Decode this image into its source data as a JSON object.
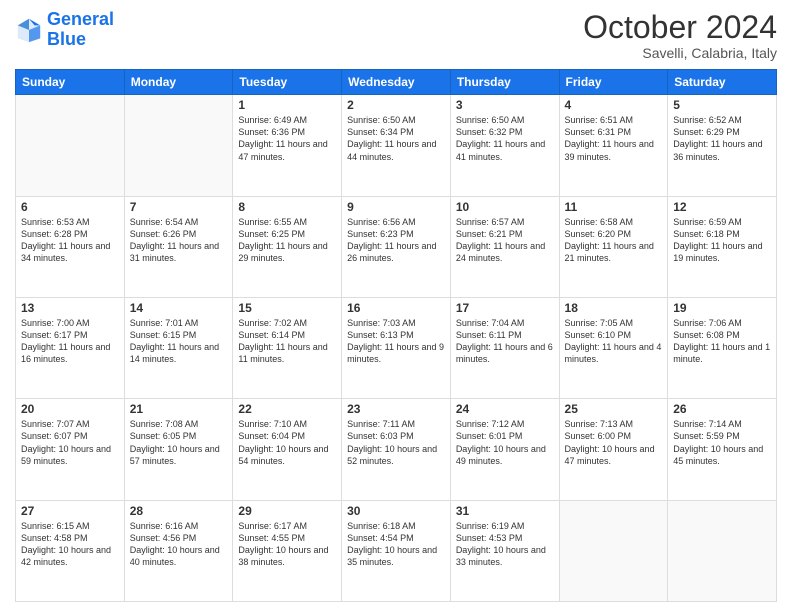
{
  "header": {
    "logo_line1": "General",
    "logo_line2": "Blue",
    "month": "October 2024",
    "location": "Savelli, Calabria, Italy"
  },
  "weekdays": [
    "Sunday",
    "Monday",
    "Tuesday",
    "Wednesday",
    "Thursday",
    "Friday",
    "Saturday"
  ],
  "weeks": [
    [
      null,
      null,
      {
        "day": "1",
        "sunrise": "6:49 AM",
        "sunset": "6:36 PM",
        "daylight": "11 hours and 47 minutes."
      },
      {
        "day": "2",
        "sunrise": "6:50 AM",
        "sunset": "6:34 PM",
        "daylight": "11 hours and 44 minutes."
      },
      {
        "day": "3",
        "sunrise": "6:50 AM",
        "sunset": "6:32 PM",
        "daylight": "11 hours and 41 minutes."
      },
      {
        "day": "4",
        "sunrise": "6:51 AM",
        "sunset": "6:31 PM",
        "daylight": "11 hours and 39 minutes."
      },
      {
        "day": "5",
        "sunrise": "6:52 AM",
        "sunset": "6:29 PM",
        "daylight": "11 hours and 36 minutes."
      }
    ],
    [
      {
        "day": "6",
        "sunrise": "6:53 AM",
        "sunset": "6:28 PM",
        "daylight": "11 hours and 34 minutes."
      },
      {
        "day": "7",
        "sunrise": "6:54 AM",
        "sunset": "6:26 PM",
        "daylight": "11 hours and 31 minutes."
      },
      {
        "day": "8",
        "sunrise": "6:55 AM",
        "sunset": "6:25 PM",
        "daylight": "11 hours and 29 minutes."
      },
      {
        "day": "9",
        "sunrise": "6:56 AM",
        "sunset": "6:23 PM",
        "daylight": "11 hours and 26 minutes."
      },
      {
        "day": "10",
        "sunrise": "6:57 AM",
        "sunset": "6:21 PM",
        "daylight": "11 hours and 24 minutes."
      },
      {
        "day": "11",
        "sunrise": "6:58 AM",
        "sunset": "6:20 PM",
        "daylight": "11 hours and 21 minutes."
      },
      {
        "day": "12",
        "sunrise": "6:59 AM",
        "sunset": "6:18 PM",
        "daylight": "11 hours and 19 minutes."
      }
    ],
    [
      {
        "day": "13",
        "sunrise": "7:00 AM",
        "sunset": "6:17 PM",
        "daylight": "11 hours and 16 minutes."
      },
      {
        "day": "14",
        "sunrise": "7:01 AM",
        "sunset": "6:15 PM",
        "daylight": "11 hours and 14 minutes."
      },
      {
        "day": "15",
        "sunrise": "7:02 AM",
        "sunset": "6:14 PM",
        "daylight": "11 hours and 11 minutes."
      },
      {
        "day": "16",
        "sunrise": "7:03 AM",
        "sunset": "6:13 PM",
        "daylight": "11 hours and 9 minutes."
      },
      {
        "day": "17",
        "sunrise": "7:04 AM",
        "sunset": "6:11 PM",
        "daylight": "11 hours and 6 minutes."
      },
      {
        "day": "18",
        "sunrise": "7:05 AM",
        "sunset": "6:10 PM",
        "daylight": "11 hours and 4 minutes."
      },
      {
        "day": "19",
        "sunrise": "7:06 AM",
        "sunset": "6:08 PM",
        "daylight": "11 hours and 1 minute."
      }
    ],
    [
      {
        "day": "20",
        "sunrise": "7:07 AM",
        "sunset": "6:07 PM",
        "daylight": "10 hours and 59 minutes."
      },
      {
        "day": "21",
        "sunrise": "7:08 AM",
        "sunset": "6:05 PM",
        "daylight": "10 hours and 57 minutes."
      },
      {
        "day": "22",
        "sunrise": "7:10 AM",
        "sunset": "6:04 PM",
        "daylight": "10 hours and 54 minutes."
      },
      {
        "day": "23",
        "sunrise": "7:11 AM",
        "sunset": "6:03 PM",
        "daylight": "10 hours and 52 minutes."
      },
      {
        "day": "24",
        "sunrise": "7:12 AM",
        "sunset": "6:01 PM",
        "daylight": "10 hours and 49 minutes."
      },
      {
        "day": "25",
        "sunrise": "7:13 AM",
        "sunset": "6:00 PM",
        "daylight": "10 hours and 47 minutes."
      },
      {
        "day": "26",
        "sunrise": "7:14 AM",
        "sunset": "5:59 PM",
        "daylight": "10 hours and 45 minutes."
      }
    ],
    [
      {
        "day": "27",
        "sunrise": "6:15 AM",
        "sunset": "4:58 PM",
        "daylight": "10 hours and 42 minutes."
      },
      {
        "day": "28",
        "sunrise": "6:16 AM",
        "sunset": "4:56 PM",
        "daylight": "10 hours and 40 minutes."
      },
      {
        "day": "29",
        "sunrise": "6:17 AM",
        "sunset": "4:55 PM",
        "daylight": "10 hours and 38 minutes."
      },
      {
        "day": "30",
        "sunrise": "6:18 AM",
        "sunset": "4:54 PM",
        "daylight": "10 hours and 35 minutes."
      },
      {
        "day": "31",
        "sunrise": "6:19 AM",
        "sunset": "4:53 PM",
        "daylight": "10 hours and 33 minutes."
      },
      null,
      null
    ]
  ]
}
